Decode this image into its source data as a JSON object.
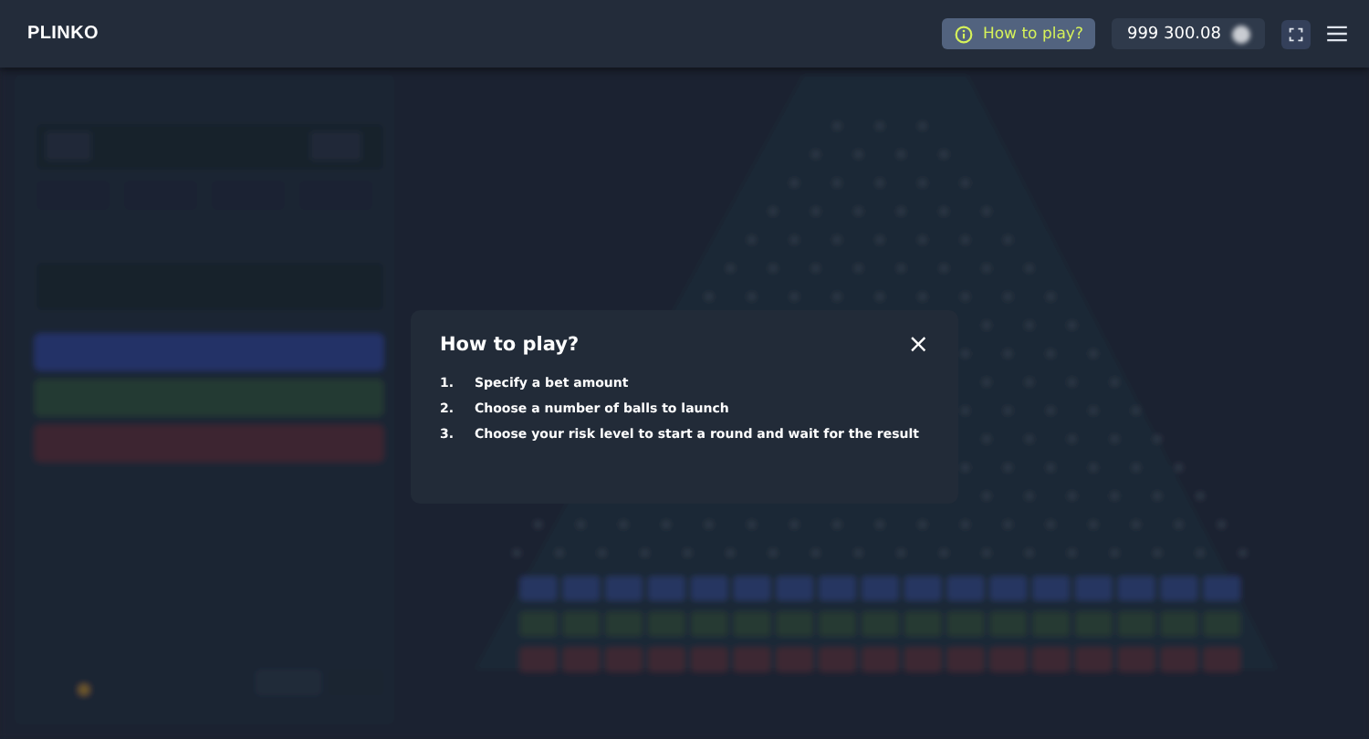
{
  "header": {
    "logo": "PLINKO",
    "help_button": "How to play?",
    "balance": "999 300.08"
  },
  "dialog": {
    "title": "How to play?",
    "close": "×",
    "steps": [
      {
        "number": "1.",
        "text": "Specify a bet amount"
      },
      {
        "number": "2.",
        "text": "Choose a number of balls to launch"
      },
      {
        "number": "3.",
        "text": "Choose your risk level to start a round and wait for the result"
      }
    ]
  }
}
